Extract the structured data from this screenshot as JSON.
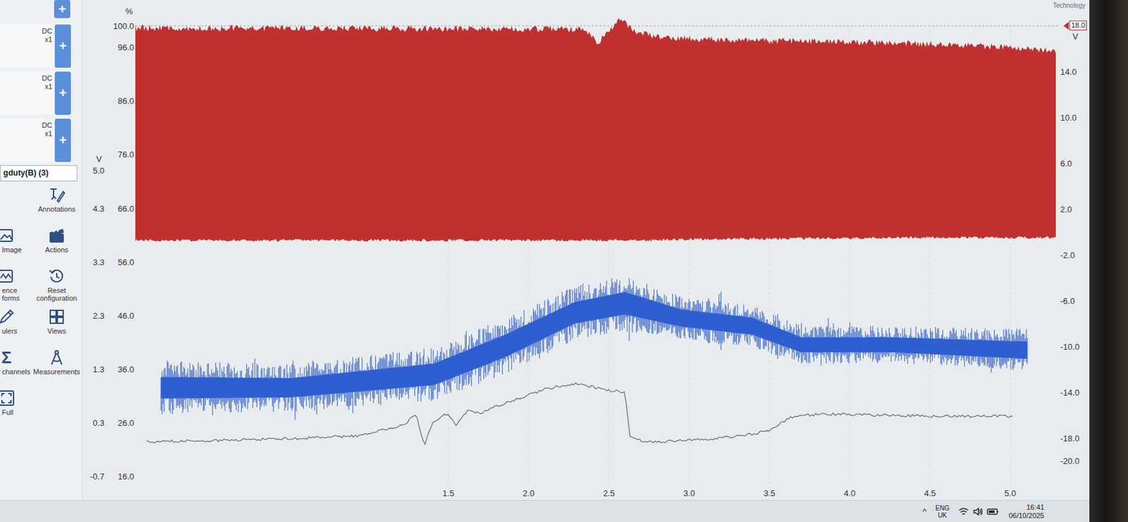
{
  "app": {
    "logo_text": "Technology"
  },
  "sidebar": {
    "top_button": "+",
    "channels": [
      {
        "coupling": "DC",
        "probe": "x1",
        "button": "+"
      },
      {
        "coupling": "DC",
        "probe": "x1",
        "button": "+"
      },
      {
        "coupling": "DC",
        "probe": "x1",
        "button": "+"
      }
    ],
    "math_channel": "gduty(B) (3)",
    "tools": [
      {
        "label": [
          "Annotations"
        ]
      },
      {
        "label": [
          "Image"
        ]
      },
      {
        "label": [
          "Actions"
        ]
      },
      {
        "label": [
          "ence",
          "forms"
        ]
      },
      {
        "label": [
          "Reset",
          "configuration"
        ]
      },
      {
        "label": [
          "ulers"
        ]
      },
      {
        "label": [
          "Views"
        ]
      },
      {
        "label": [
          "channels"
        ],
        "icon": "Σ"
      },
      {
        "label": [
          "Measurements"
        ]
      },
      {
        "label": [
          "Full"
        ]
      }
    ]
  },
  "chart": {
    "left_unit": "%",
    "left_ticks": [
      "100.0",
      "96.0",
      "86.0",
      "76.0",
      "66.0",
      "56.0",
      "46.0",
      "36.0",
      "26.0",
      "16.0"
    ],
    "volt_unit": "V",
    "volt_ticks": [
      "5.0",
      "4.3",
      "3.3",
      "2.3",
      "1.3",
      "0.3",
      "-0.7"
    ],
    "right_marker": "18.0",
    "right_unit": "V",
    "right_ticks": [
      "14.0",
      "10.0",
      "6.0",
      "2.0",
      "-2.0",
      "-6.0",
      "-10.0",
      "-14.0",
      "-18.0",
      "-20.0"
    ],
    "x_ticks": [
      "1.5",
      "2.0",
      "2.5",
      "3.0",
      "3.5",
      "4.0",
      "4.5",
      "5.0"
    ],
    "series": [
      {
        "kind": "band",
        "color": "#c0302e",
        "times": [
          -0.46,
          0.5,
          1.5,
          2.0,
          2.35,
          2.44,
          2.47,
          2.52,
          2.58,
          2.64,
          2.75,
          3.0,
          3.5,
          4.0,
          4.5,
          5.0,
          5.29
        ],
        "upper": [
          99.6,
          99.6,
          99.5,
          99.4,
          99.4,
          96.5,
          98.5,
          99.8,
          101.5,
          99.2,
          98.2,
          97.6,
          97.2,
          97.0,
          96.6,
          96.0,
          95.3
        ],
        "lower": [
          60.0,
          60.0,
          60.0,
          60.0,
          60.0,
          60.0,
          60.0,
          60.0,
          60.0,
          60.0,
          60.0,
          60.2,
          60.3,
          60.4,
          60.5,
          60.5,
          60.5
        ]
      },
      {
        "kind": "noisy",
        "color": "#2f5fd0",
        "times": [
          -0.29,
          0.52,
          1.41,
          1.85,
          2.29,
          2.6,
          2.95,
          3.39,
          3.7,
          4.27,
          5.11
        ],
        "upper": [
          37.5,
          37.0,
          40.0,
          45.5,
          51.5,
          53.5,
          49.5,
          48.0,
          44.0,
          44.0,
          43.5
        ],
        "lower": [
          27.5,
          28.0,
          30.0,
          35.0,
          41.5,
          43.0,
          41.5,
          40.0,
          37.0,
          37.0,
          35.5
        ]
      },
      {
        "kind": "line",
        "color": "#707070",
        "times": [
          -0.38,
          0.52,
          0.96,
          1.22,
          1.3,
          1.35,
          1.4,
          1.49,
          1.55,
          1.62,
          1.7,
          1.85,
          2.11,
          2.29,
          2.51,
          2.6,
          2.63,
          2.73,
          3.17,
          3.48,
          3.65,
          3.83,
          4.49,
          5.02
        ],
        "values": [
          22.4,
          23.0,
          23.6,
          25.6,
          27.5,
          21.6,
          26.0,
          27.6,
          25.5,
          28.3,
          27.8,
          29.6,
          32.3,
          33.3,
          32.0,
          31.6,
          23.6,
          22.3,
          23.0,
          24.3,
          27.2,
          27.6,
          27.2,
          27.2
        ]
      }
    ]
  },
  "taskbar": {
    "tray_chevron": "^",
    "language": "ENG",
    "region": "UK",
    "time": "16:41",
    "date": "06/10/2025"
  }
}
